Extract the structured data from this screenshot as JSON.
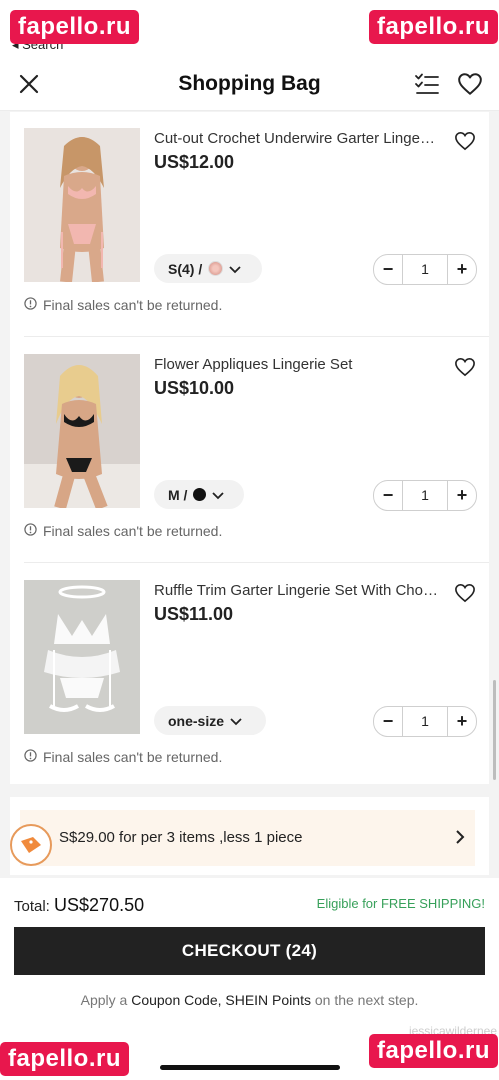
{
  "status_bar": {
    "back_label": "◂ Search"
  },
  "watermarks": {
    "text": "fapello.ru",
    "bottom_right_small": "jessicawildernee"
  },
  "header": {
    "title": "Shopping Bag",
    "close_icon": "close-icon",
    "checklist_icon": "checklist-icon",
    "wishlist_icon": "heart-icon"
  },
  "items": [
    {
      "name": "Cut-out Crochet Underwire Garter Lingerie Set",
      "price": "US$12.00",
      "variant": "S(4) /",
      "variant_swatch": "pink-floral",
      "qty": "1",
      "note": "Final sales can't be returned.",
      "image_colors": {
        "bg": "#e9e3df",
        "skin": "#d9a88a",
        "accent": "#f2b7b0"
      }
    },
    {
      "name": "Flower Appliques Lingerie Set",
      "price": "US$10.00",
      "variant": "M /",
      "variant_swatch": "black",
      "qty": "1",
      "note": "Final sales can't be returned.",
      "image_colors": {
        "bg": "#d8d2ce",
        "skin": "#d7a686",
        "accent": "#1a1a1a"
      }
    },
    {
      "name": "Ruffle Trim Garter Lingerie Set With Choker",
      "price": "US$11.00",
      "variant": "one-size",
      "variant_swatch": "",
      "qty": "1",
      "note": "Final sales can't be returned.",
      "image_colors": {
        "bg": "#cfcfcb",
        "skin": "#cfcfcb",
        "accent": "#ffffff"
      }
    }
  ],
  "promo": {
    "text": "S$29.00 for per 3 items ,less 1 piece",
    "icon": "discount-tag-icon"
  },
  "footer": {
    "total_label": "Total:",
    "total_value": "US$270.50",
    "free_shipping": "Eligible for FREE SHIPPING!",
    "checkout_label": "CHECKOUT (24)",
    "coupon_prefix": "Apply a",
    "coupon_link1": "Coupon Code, SHEIN Points",
    "coupon_suffix": "on the next step."
  },
  "colors": {
    "accent_dark": "#222222",
    "promo_bg": "#fdf5ec",
    "free_ship_green": "#37a05a",
    "watermark_pink": "#e8174d"
  }
}
